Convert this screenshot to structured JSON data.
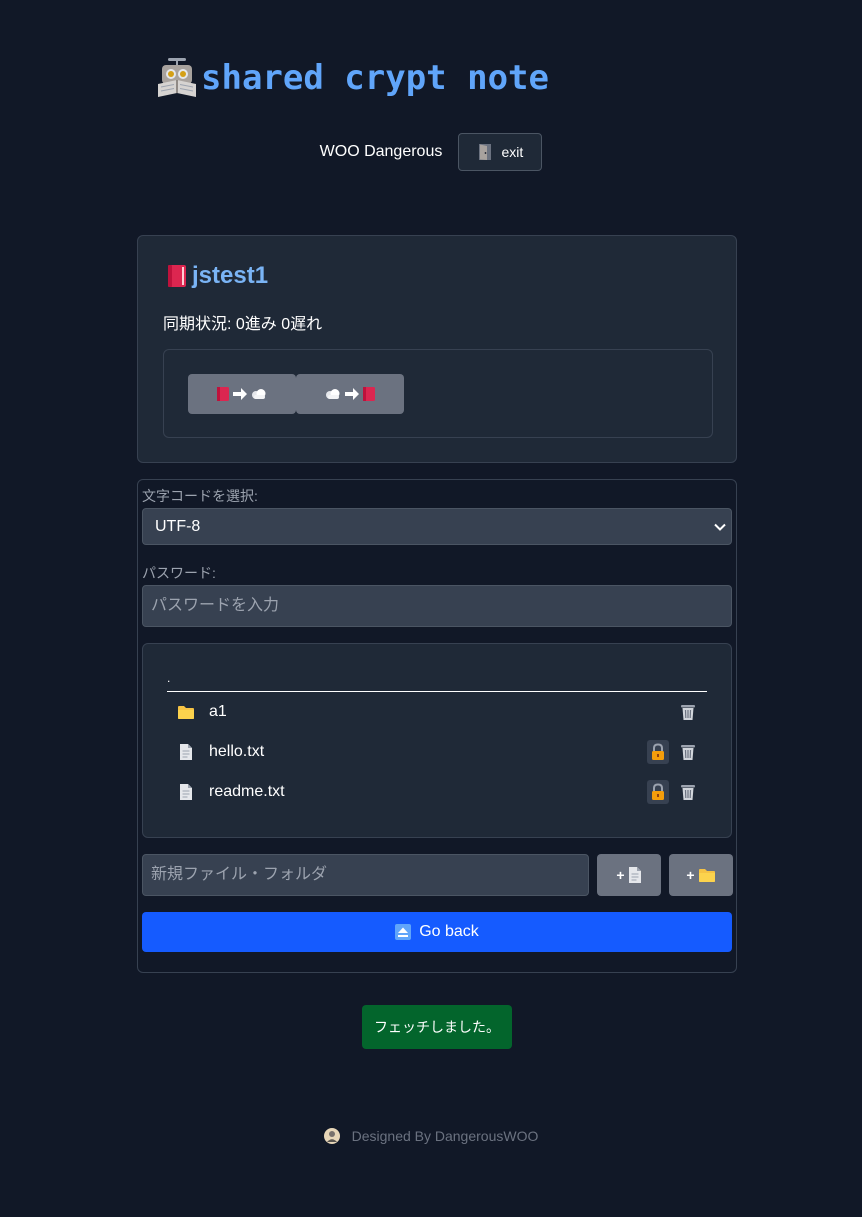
{
  "header": {
    "title": "shared crypt note",
    "username": "WOO Dangerous",
    "exit_label": "exit"
  },
  "note": {
    "title": "jstest1",
    "sync_status": "同期状況: 0進み 0遅れ",
    "push_icons": "book-arrow-cloud",
    "pull_icons": "cloud-arrow-book"
  },
  "form": {
    "encoding_label": "文字コードを選択:",
    "encoding_value": "UTF-8",
    "password_label": "パスワード:",
    "password_placeholder": "パスワードを入力"
  },
  "files": {
    "current_path": ".",
    "items": [
      {
        "name": "a1",
        "type": "folder",
        "icon": "folder-icon",
        "locked": false
      },
      {
        "name": "hello.txt",
        "type": "file",
        "icon": "document-icon",
        "locked": true
      },
      {
        "name": "readme.txt",
        "type": "file",
        "icon": "document-icon",
        "locked": true
      }
    ]
  },
  "new_item": {
    "placeholder": "新規ファイル・フォルダ",
    "add_file_label": "+",
    "add_folder_label": "+"
  },
  "go_back_label": "Go back",
  "toast": "フェッチしました。",
  "footer": "Designed By DangerousWOO",
  "colors": {
    "background": "#111827",
    "card": "#1f2937",
    "accent_title": "#60a5fa",
    "primary_button": "#155bff",
    "success_toast": "#03652c",
    "secondary_button": "#6b7280"
  }
}
